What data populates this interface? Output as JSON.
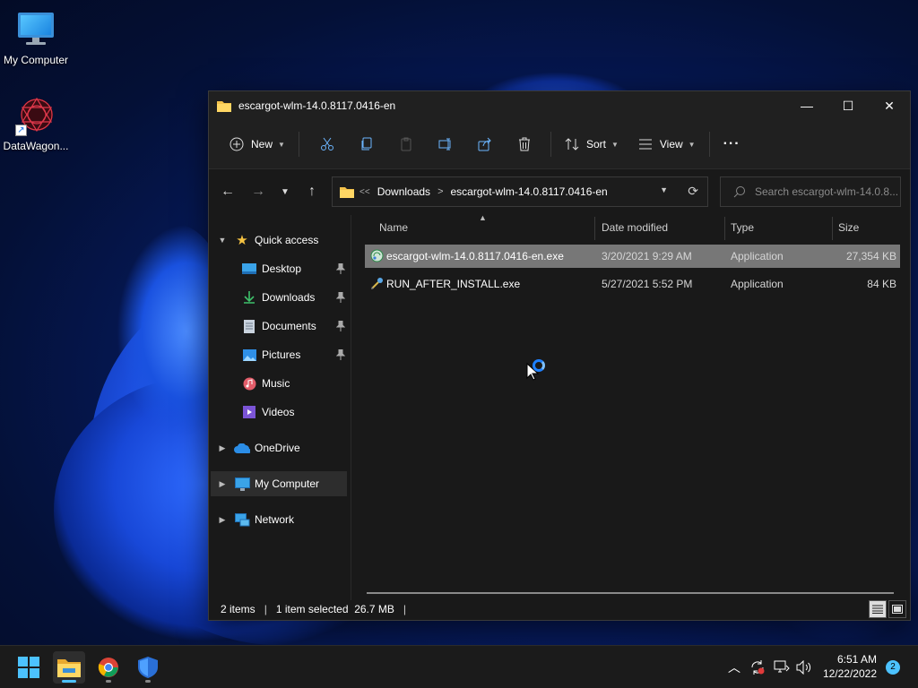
{
  "desktop": {
    "icons": [
      {
        "label": "My Computer"
      },
      {
        "label": "DataWagon..."
      }
    ]
  },
  "window": {
    "title": "escargot-wlm-14.0.8117.0416-en",
    "controls": {
      "minimize": "—",
      "maximize": "☐",
      "close": "✕"
    }
  },
  "commandbar": {
    "new_label": "New",
    "sort_label": "Sort",
    "view_label": "View",
    "more_label": "···"
  },
  "address": {
    "crumbs": [
      "Downloads",
      "escargot-wlm-14.0.8117.0416-en"
    ],
    "overflow": "<<",
    "search_placeholder": "Search escargot-wlm-14.0.8..."
  },
  "nav": {
    "quick_access": "Quick access",
    "pinned": [
      {
        "label": "Desktop"
      },
      {
        "label": "Downloads"
      },
      {
        "label": "Documents"
      },
      {
        "label": "Pictures"
      },
      {
        "label": "Music"
      },
      {
        "label": "Videos"
      }
    ],
    "onedrive": "OneDrive",
    "my_computer": "My Computer",
    "network": "Network"
  },
  "files": {
    "columns": {
      "name": "Name",
      "date": "Date modified",
      "type": "Type",
      "size": "Size"
    },
    "rows": [
      {
        "name": "escargot-wlm-14.0.8117.0416-en.exe",
        "date": "3/20/2021 9:29 AM",
        "type": "Application",
        "size": "27,354 KB",
        "selected": true
      },
      {
        "name": "RUN_AFTER_INSTALL.exe",
        "date": "5/27/2021 5:52 PM",
        "type": "Application",
        "size": "84 KB",
        "selected": false
      }
    ]
  },
  "status": {
    "items": "2 items",
    "selection": "1 item selected  26.7 MB"
  },
  "taskbar": {
    "apps": [
      "windows-start",
      "file-explorer",
      "chrome",
      "windows-security"
    ],
    "time": "6:51 AM",
    "date": "12/22/2022",
    "notifications": "2"
  },
  "colors": {
    "accent": "#4cc2ff",
    "selection": "#777777",
    "window_bg": "#191919"
  }
}
